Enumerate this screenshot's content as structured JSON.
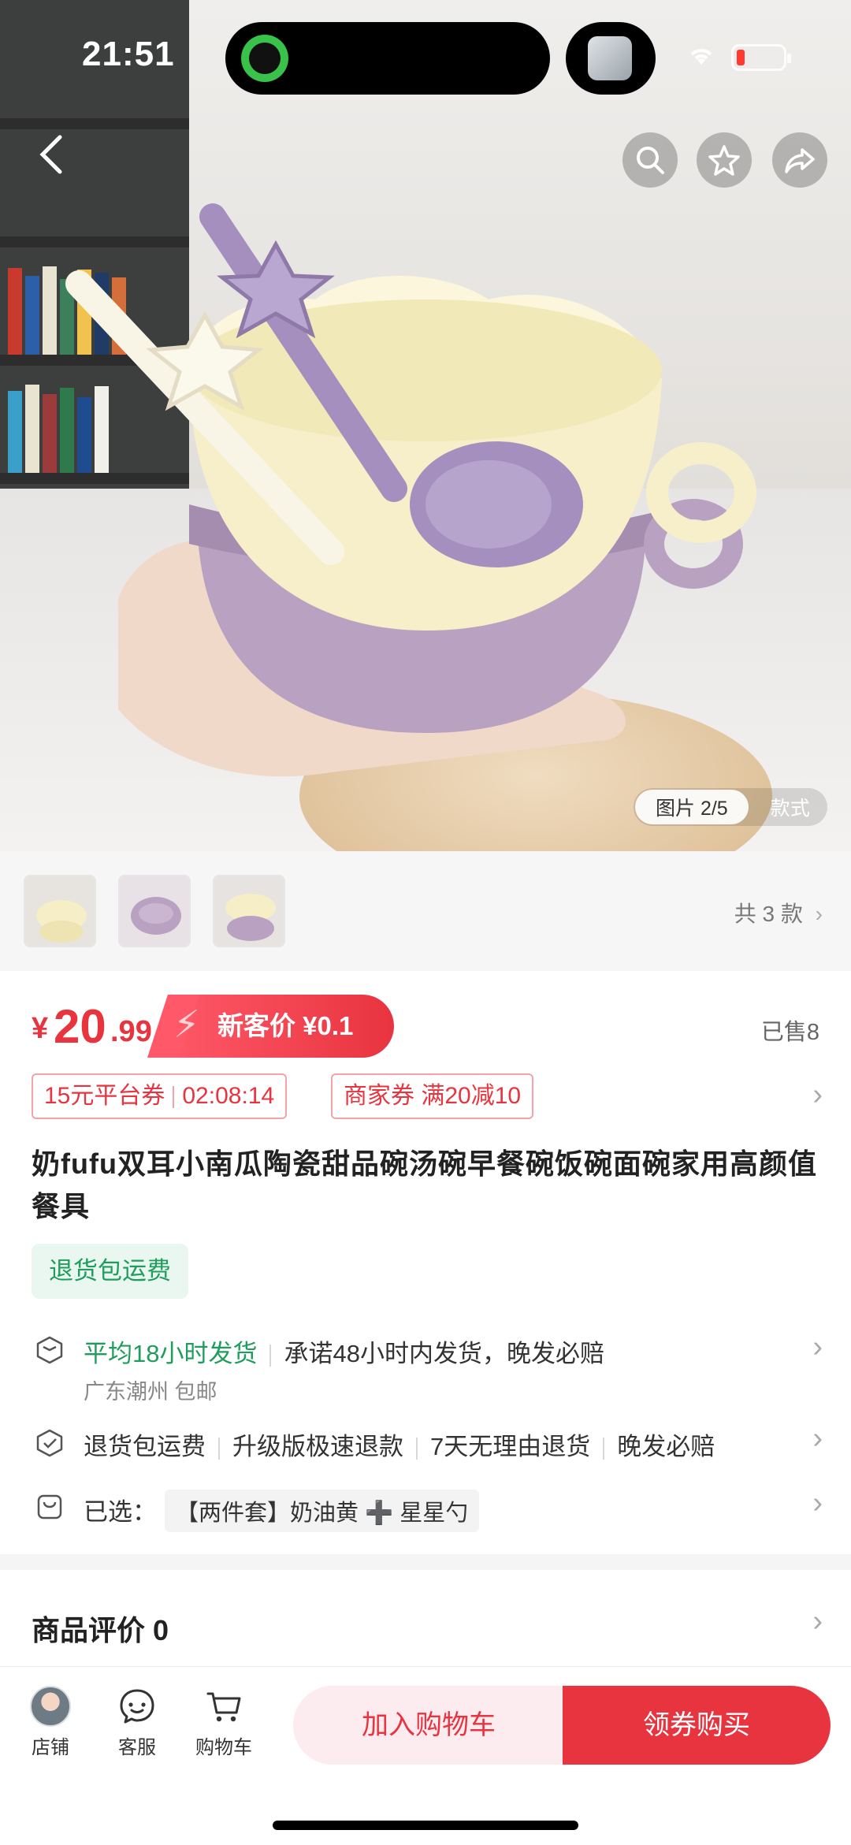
{
  "status_bar": {
    "time": "21:51"
  },
  "gallery": {
    "pager_current": "图片 2/5",
    "pager_alt": "款式"
  },
  "variants": {
    "total_label": "共 3 款"
  },
  "price": {
    "currency": "¥",
    "integer": "20",
    "decimal": ".99",
    "new_customer_label": "新客价 ¥0.1",
    "sold": "已售8"
  },
  "coupons": {
    "platform_label": "15元平台券",
    "platform_timer": "02:08:14",
    "merchant_label": "商家券 满20减10"
  },
  "product": {
    "title": "奶fufu双耳小南瓜陶瓷甜品碗汤碗早餐碗饭碗面碗家用高颜值餐具",
    "return_tag": "退货包运费"
  },
  "shipping": {
    "avg_label": "平均18小时发货",
    "promise": "承诺48小时内发货，晚发必赔",
    "origin": "广东潮州 包邮"
  },
  "guarantees": {
    "items": [
      "退货包运费",
      "升级版极速退款",
      "7天无理由退货",
      "晚发必赔"
    ]
  },
  "selection": {
    "label": "已选：",
    "value": "【两件套】奶油黄 ➕ 星星勺"
  },
  "reviews": {
    "title": "商品评价 0"
  },
  "bottom_bar": {
    "store": "店铺",
    "service": "客服",
    "cart": "购物车",
    "add_to_cart": "加入购物车",
    "buy": "领券购买"
  },
  "colors": {
    "accent": "#e8343f",
    "green": "#1f9d5c"
  }
}
